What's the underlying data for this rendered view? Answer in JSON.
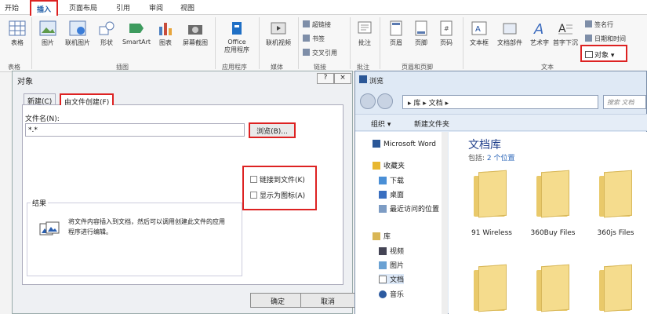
{
  "ribbon": {
    "tabs": [
      "开始",
      "插入",
      "页面布局",
      "引用",
      "审阅",
      "视图"
    ],
    "active_tab": "插入",
    "buttons": {
      "table": "表格",
      "picture": "图片",
      "online_picture": "联机图片",
      "shapes": "形状",
      "smartart": "SmartArt",
      "chart": "图表",
      "screenshot": "屏幕截图",
      "office_apps_1": "Office",
      "office_apps_2": "应用程序",
      "online_video": "联机视频",
      "hyperlink": "超链接",
      "bookmark": "书签",
      "cross_ref": "交叉引用",
      "comment": "批注",
      "header": "页眉",
      "footer": "页脚",
      "page_number": "页码",
      "textbox": "文本框",
      "quick_parts": "文档部件",
      "wordart": "艺术字",
      "dropcap": "首字下沉",
      "signature_line": "签名行",
      "datetime": "日期和时间",
      "object": "对象"
    },
    "groups": {
      "tables": "表格",
      "illustrations": "插图",
      "apps": "应用程序",
      "media": "媒体",
      "links": "链接",
      "comments": "批注",
      "header_footer": "页眉和页脚",
      "text": "文本"
    }
  },
  "dialog": {
    "title": "对象",
    "help": "?",
    "close": "×",
    "tab_new": "新建(C)",
    "tab_from_file": "由文件创建(F)",
    "filename_label": "文件名(N):",
    "filename_value": "*.*",
    "browse": "浏览(B)...",
    "link_to_file": "链接到文件(K)",
    "display_as_icon": "显示为图标(A)",
    "result_label": "结果",
    "result_text": "将文件内容插入到文档，然后可以调用创建此文件的应用程序进行编辑。",
    "ok": "确定",
    "cancel": "取消"
  },
  "browse": {
    "title": "浏览",
    "address": [
      "库",
      "文档"
    ],
    "search_placeholder": "搜索 文档",
    "organize": "组织",
    "new_folder": "新建文件夹",
    "nav": {
      "app": "Microsoft Word",
      "favorites": "收藏夹",
      "downloads": "下载",
      "desktop": "桌面",
      "recent": "最近访问的位置",
      "libraries": "库",
      "videos": "视频",
      "pictures": "图片",
      "documents": "文档",
      "music": "音乐"
    },
    "library_title": "文档库",
    "library_sub_prefix": "包括:",
    "library_sub_link": "2 个位置",
    "folders": [
      "91 Wireless",
      "360Buy Files",
      "360js Files"
    ]
  }
}
